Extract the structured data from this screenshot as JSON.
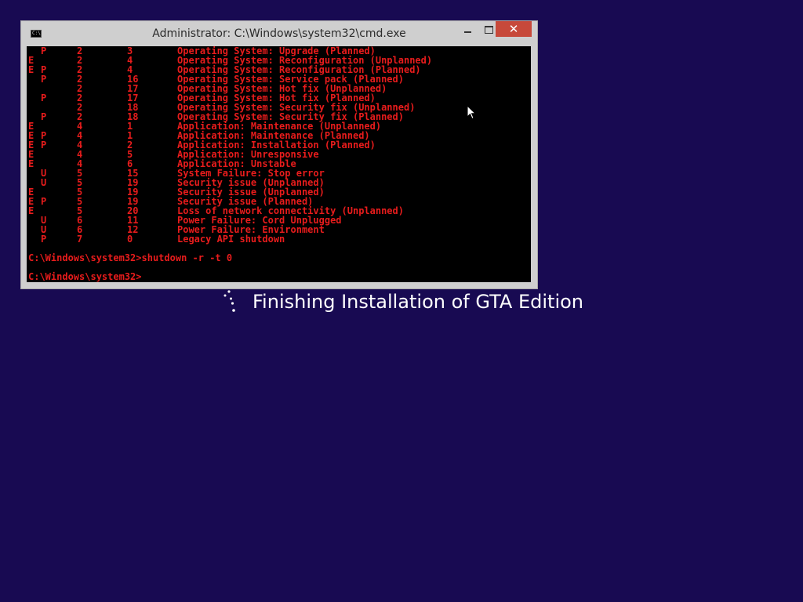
{
  "window": {
    "title": "Administrator: C:\\Windows\\system32\\cmd.exe",
    "icon_label": "C:\\",
    "close_glyph": "✕"
  },
  "console": {
    "text_color": "#e81c1c",
    "rows": [
      {
        "e": "",
        "pu": "P",
        "major": "2",
        "minor": "3",
        "reason": "Operating System: Upgrade (Planned)"
      },
      {
        "e": "E",
        "pu": "",
        "major": "2",
        "minor": "4",
        "reason": "Operating System: Reconfiguration (Unplanned)"
      },
      {
        "e": "E",
        "pu": "P",
        "major": "2",
        "minor": "4",
        "reason": "Operating System: Reconfiguration (Planned)"
      },
      {
        "e": "",
        "pu": "P",
        "major": "2",
        "minor": "16",
        "reason": "Operating System: Service pack (Planned)"
      },
      {
        "e": "",
        "pu": "",
        "major": "2",
        "minor": "17",
        "reason": "Operating System: Hot fix (Unplanned)"
      },
      {
        "e": "",
        "pu": "P",
        "major": "2",
        "minor": "17",
        "reason": "Operating System: Hot fix (Planned)"
      },
      {
        "e": "",
        "pu": "",
        "major": "2",
        "minor": "18",
        "reason": "Operating System: Security fix (Unplanned)"
      },
      {
        "e": "",
        "pu": "P",
        "major": "2",
        "minor": "18",
        "reason": "Operating System: Security fix (Planned)"
      },
      {
        "e": "E",
        "pu": "",
        "major": "4",
        "minor": "1",
        "reason": "Application: Maintenance (Unplanned)"
      },
      {
        "e": "E",
        "pu": "P",
        "major": "4",
        "minor": "1",
        "reason": "Application: Maintenance (Planned)"
      },
      {
        "e": "E",
        "pu": "P",
        "major": "4",
        "minor": "2",
        "reason": "Application: Installation (Planned)"
      },
      {
        "e": "E",
        "pu": "",
        "major": "4",
        "minor": "5",
        "reason": "Application: Unresponsive"
      },
      {
        "e": "E",
        "pu": "",
        "major": "4",
        "minor": "6",
        "reason": "Application: Unstable"
      },
      {
        "e": "",
        "pu": "U",
        "major": "5",
        "minor": "15",
        "reason": "System Failure: Stop error"
      },
      {
        "e": "",
        "pu": "U",
        "major": "5",
        "minor": "19",
        "reason": "Security issue (Unplanned)"
      },
      {
        "e": "E",
        "pu": "",
        "major": "5",
        "minor": "19",
        "reason": "Security issue (Unplanned)"
      },
      {
        "e": "E",
        "pu": "P",
        "major": "5",
        "minor": "19",
        "reason": "Security issue (Planned)"
      },
      {
        "e": "E",
        "pu": "",
        "major": "5",
        "minor": "20",
        "reason": "Loss of network connectivity (Unplanned)"
      },
      {
        "e": "",
        "pu": "U",
        "major": "6",
        "minor": "11",
        "reason": "Power Failure: Cord Unplugged"
      },
      {
        "e": "",
        "pu": "U",
        "major": "6",
        "minor": "12",
        "reason": "Power Failure: Environment"
      },
      {
        "e": "",
        "pu": "P",
        "major": "7",
        "minor": "0",
        "reason": "Legacy API shutdown"
      }
    ],
    "command_line": "C:\\Windows\\system32>shutdown -r -t 0",
    "current_prompt": "C:\\Windows\\system32>"
  },
  "install_status": {
    "text": "Finishing Installation of GTA Edition"
  }
}
